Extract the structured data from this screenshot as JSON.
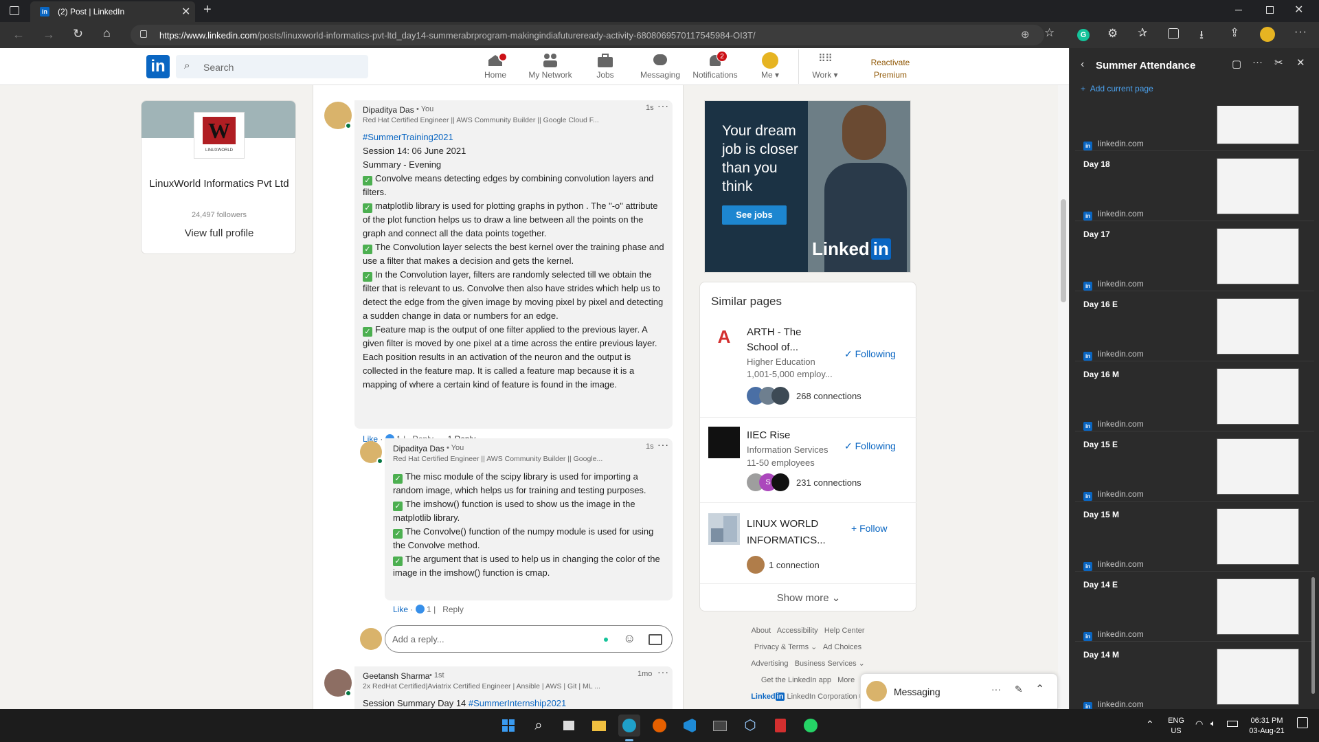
{
  "browser": {
    "tab_title": "(2) Post | LinkedIn",
    "url_host": "https://www.linkedin.com",
    "url_path": "/posts/linuxworld-informatics-pvt-ltd_day14-summerabrprogram-makingindiafutureready-activity-6808069570117545984-OI3T/"
  },
  "linkedin_nav": {
    "search_placeholder": "Search",
    "items": [
      {
        "label": "Home",
        "badge": ""
      },
      {
        "label": "My Network",
        "badge": ""
      },
      {
        "label": "Jobs",
        "badge": ""
      },
      {
        "label": "Messaging",
        "badge": ""
      },
      {
        "label": "Notifications",
        "badge": "2"
      },
      {
        "label": "Me",
        "badge": ""
      },
      {
        "label": "Work",
        "badge": ""
      }
    ],
    "premium_line1": "Reactivate",
    "premium_line2": "Premium"
  },
  "profile_card": {
    "company": "LinuxWorld Informatics Pvt Ltd",
    "followers": "24,497 followers",
    "view_profile": "View full profile",
    "logo_text": "LINUXWORLD"
  },
  "comment1": {
    "author": "Dipaditya Das",
    "you": "• You",
    "headline": "Red Hat Certified Engineer || AWS Community Builder || Google Cloud F...",
    "time": "1s",
    "hashtag": "#SummerTraining2021",
    "line1": "Session 14: 06 June 2021",
    "line2": "Summary - Evening",
    "p1": "Convolve means detecting edges by combining convolution layers and filters.",
    "p2": "matplotlib library is used for plotting graphs in python . The \"-o\" attribute of the plot function helps us to draw a line between all the points on the graph and connect all the data points together.",
    "p3": "The Convolution layer selects the best kernel over the training phase and use a filter that makes a decision and gets the kernel.",
    "p4": "In the Convolution layer, filters are randomly selected till we obtain the filter that is relevant to us. Convolve then also have strides which help us to detect the edge from the given image by moving pixel by pixel and detecting a sudden change in data or numbers for an edge.",
    "p5": "Feature map is the output of one filter applied to the previous layer. A given filter is moved by one pixel at a time across the entire previous layer. Each position results in an activation of the neuron and the output is collected in the feature map. It is called a feature map because it is a mapping of where a certain kind of feature is found in the image.",
    "like": "Like",
    "likes": "1",
    "reply": "Reply",
    "replies": "1 Reply"
  },
  "comment2": {
    "author": "Dipaditya Das",
    "you": "• You",
    "headline": "Red Hat Certified Engineer || AWS Community Builder || Google...",
    "time": "1s",
    "p1": "The misc module of the scipy library is used for importing a random image, which helps us for training and testing purposes.",
    "p2": "The imshow() function is used to show us the image in the matplotlib library.",
    "p3": "The Convolve() function of the numpy module is used for using the Convolve method.",
    "p4": "The argument that is used to help us in changing the color of the image in the imshow() function is cmap.",
    "like": "Like",
    "likes": "1",
    "reply": "Reply"
  },
  "reply_box": {
    "placeholder": "Add a reply..."
  },
  "comment3": {
    "author": "Geetansh Sharma",
    "degree": "• 1st",
    "headline": "2x RedHat Certified|Aviatrix Certified Engineer | Ansible | AWS | Git | ML ...",
    "time": "1mo",
    "text": "Session Summary Day 14",
    "hashtag": "#SummerInternship2021"
  },
  "ad": {
    "line1": "Your dream",
    "line2": "job is closer",
    "line3": "than you",
    "line4": "think",
    "button": "See jobs",
    "brand": "Linked"
  },
  "similar": {
    "title": "Similar pages",
    "pages": [
      {
        "name1": "ARTH - The",
        "name2": "School of...",
        "industry": "Higher Education",
        "size": "1,001-5,000 employ...",
        "action": "Following",
        "connections": "268 connections"
      },
      {
        "name1": "IIEC Rise",
        "name2": "",
        "industry": "Information Services",
        "size": "11-50 employees",
        "action": "Following",
        "connections": "231 connections"
      },
      {
        "name1": "LINUX WORLD",
        "name2": "INFORMATICS...",
        "industry": "",
        "size": "",
        "action": "Follow",
        "connections": "1 connection"
      }
    ],
    "show_more": "Show more"
  },
  "footer": {
    "links": [
      "About",
      "Accessibility",
      "Help Center",
      "Privacy & Terms",
      "Ad Choices",
      "Advertising",
      "Business Services",
      "Get the LinkedIn app",
      "More"
    ],
    "corp": "LinkedIn Corporation ©"
  },
  "messaging": {
    "label": "Messaging"
  },
  "side_panel": {
    "title": "Summer Attendance",
    "add_page": "Add current page",
    "site": "linkedin.com",
    "items": [
      "",
      "Day 18",
      "Day 17",
      "Day 16 E",
      "Day 16 M",
      "Day 15 E",
      "Day 15 M",
      "Day 14 E",
      "Day 14 M"
    ]
  },
  "taskbar": {
    "lang1": "ENG",
    "lang2": "US",
    "time": "06:31 PM",
    "date": "03-Aug-21"
  }
}
